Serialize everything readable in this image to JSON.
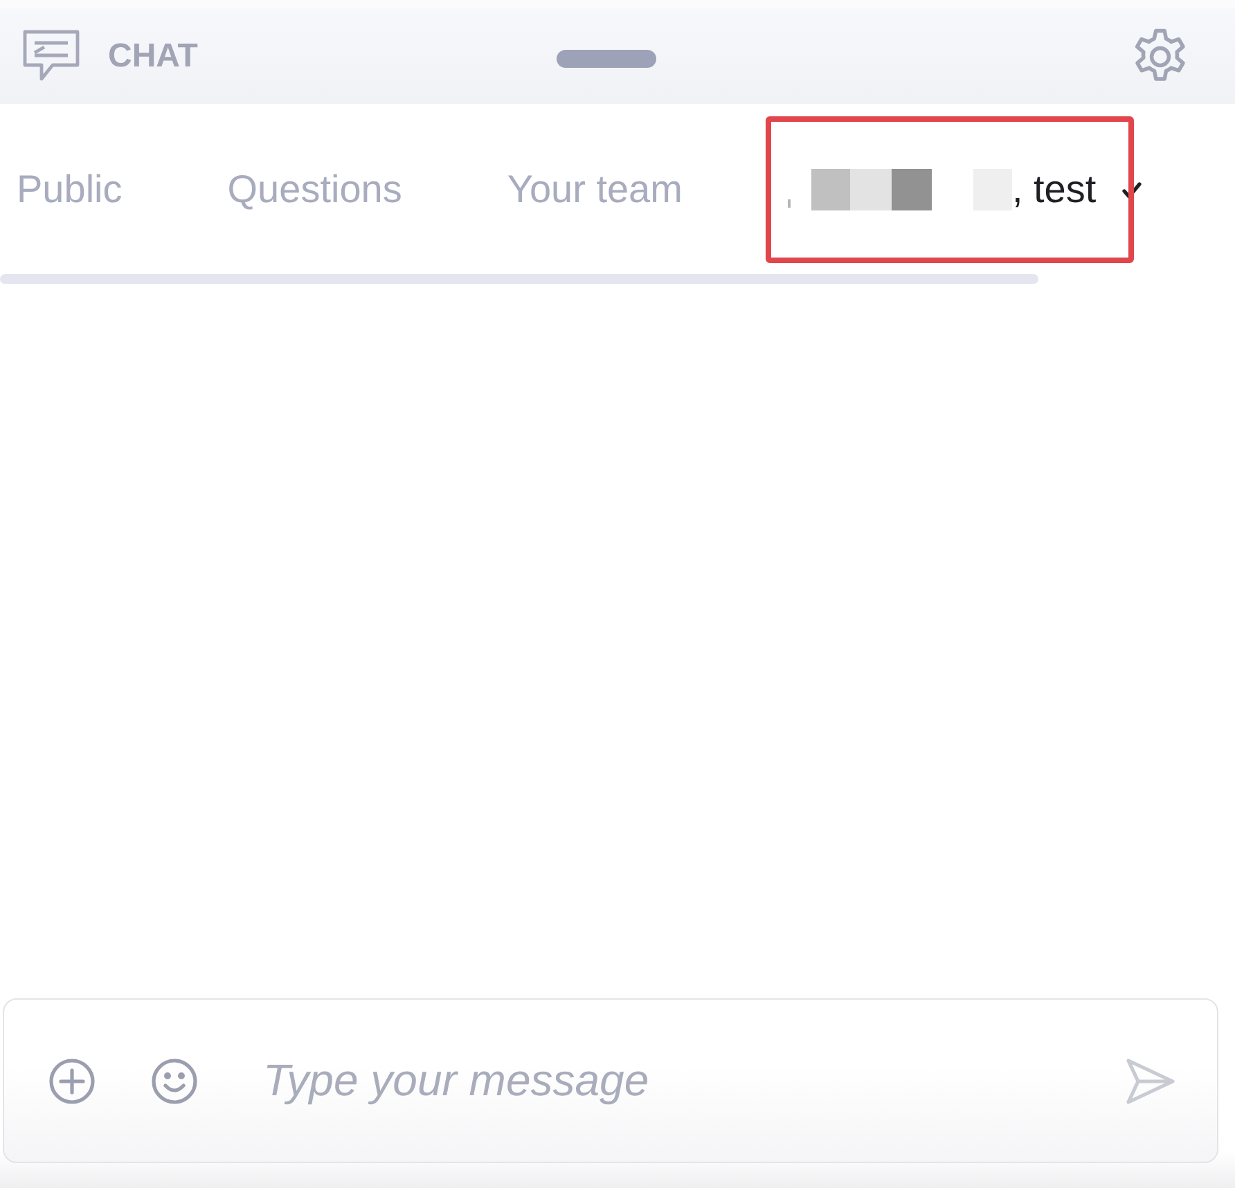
{
  "header": {
    "title": "CHAT"
  },
  "tabs": [
    {
      "label": "Public",
      "selected": false,
      "redacted": false,
      "checked": false,
      "highlighted": false
    },
    {
      "label": "Questions",
      "selected": false,
      "redacted": false,
      "checked": false,
      "highlighted": false
    },
    {
      "label": "Your team",
      "selected": false,
      "redacted": false,
      "checked": false,
      "highlighted": false
    },
    {
      "label": ", test",
      "selected": true,
      "redacted": true,
      "checked": true,
      "highlighted": true
    }
  ],
  "composer": {
    "placeholder": "Type your message"
  }
}
